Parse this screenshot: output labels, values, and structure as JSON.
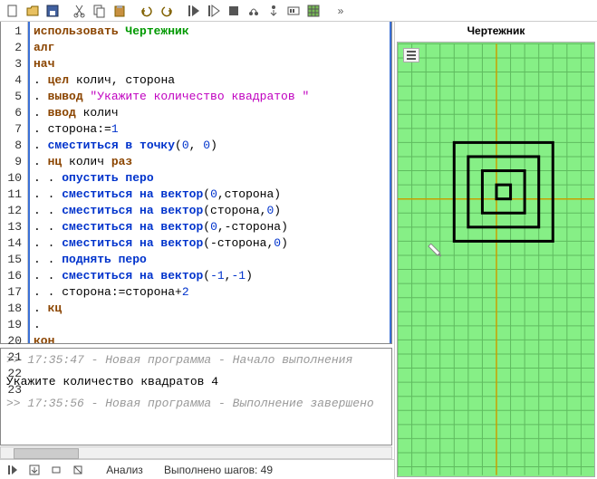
{
  "canvas": {
    "title": "Чертежник"
  },
  "toolbar_icons": [
    "new",
    "open",
    "save",
    "cut",
    "copy",
    "paste",
    "undo",
    "redo",
    "run",
    "run-skip",
    "stop",
    "step-over",
    "step-into",
    "pair",
    "grid",
    "more"
  ],
  "code": {
    "lines": [
      {
        "n": 1,
        "segs": [
          [
            "k-brown",
            "использовать "
          ],
          [
            "k-green",
            "Чертежник"
          ]
        ]
      },
      {
        "n": 2,
        "segs": [
          [
            "k-brown",
            "алг"
          ]
        ]
      },
      {
        "n": 3,
        "segs": [
          [
            "k-brown",
            "нач"
          ]
        ]
      },
      {
        "n": 4,
        "segs": [
          [
            "",
            ". "
          ],
          [
            "k-brown",
            "цел "
          ],
          [
            "",
            "колич, сторона"
          ]
        ]
      },
      {
        "n": 5,
        "segs": [
          [
            "",
            ". "
          ],
          [
            "k-brown",
            "вывод "
          ],
          [
            "k-mag",
            "\"Укажите количество квадратов \""
          ]
        ]
      },
      {
        "n": 6,
        "segs": [
          [
            "",
            ". "
          ],
          [
            "k-brown",
            "ввод "
          ],
          [
            "",
            "колич"
          ]
        ]
      },
      {
        "n": 7,
        "segs": [
          [
            "",
            ". сторона:="
          ],
          [
            "k-num",
            "1"
          ]
        ]
      },
      {
        "n": 8,
        "segs": [
          [
            "",
            ". "
          ],
          [
            "k-blue",
            "сместиться в точку"
          ],
          [
            "",
            "("
          ],
          [
            "k-num",
            "0"
          ],
          [
            "",
            ", "
          ],
          [
            "k-num",
            "0"
          ],
          [
            "",
            ")"
          ]
        ]
      },
      {
        "n": 9,
        "segs": [
          [
            "",
            ". "
          ],
          [
            "k-brown",
            "нц "
          ],
          [
            "",
            "колич "
          ],
          [
            "k-brown",
            "раз"
          ]
        ]
      },
      {
        "n": 10,
        "segs": [
          [
            "",
            ". . "
          ],
          [
            "k-blue",
            "опустить перо"
          ]
        ]
      },
      {
        "n": 11,
        "segs": [
          [
            "",
            ". . "
          ],
          [
            "k-blue",
            "сместиться на вектор"
          ],
          [
            "",
            "("
          ],
          [
            "k-num",
            "0"
          ],
          [
            "",
            ",сторона)"
          ]
        ]
      },
      {
        "n": 12,
        "segs": [
          [
            "",
            ". . "
          ],
          [
            "k-blue",
            "сместиться на вектор"
          ],
          [
            "",
            "(сторона,"
          ],
          [
            "k-num",
            "0"
          ],
          [
            "",
            ")"
          ]
        ]
      },
      {
        "n": 13,
        "segs": [
          [
            "",
            ". . "
          ],
          [
            "k-blue",
            "сместиться на вектор"
          ],
          [
            "",
            "("
          ],
          [
            "k-num",
            "0"
          ],
          [
            "",
            ",-сторона)"
          ]
        ]
      },
      {
        "n": 14,
        "segs": [
          [
            "",
            ". . "
          ],
          [
            "k-blue",
            "сместиться на вектор"
          ],
          [
            "",
            "(-сторона,"
          ],
          [
            "k-num",
            "0"
          ],
          [
            "",
            ")"
          ]
        ]
      },
      {
        "n": 15,
        "segs": [
          [
            "",
            ". . "
          ],
          [
            "k-blue",
            "поднять перо"
          ]
        ]
      },
      {
        "n": 16,
        "segs": [
          [
            "",
            ". . "
          ],
          [
            "k-blue",
            "сместиться на вектор"
          ],
          [
            "",
            "("
          ],
          [
            "k-num",
            "-1"
          ],
          [
            "",
            ","
          ],
          [
            "k-num",
            "-1"
          ],
          [
            "",
            ")"
          ]
        ]
      },
      {
        "n": 17,
        "segs": [
          [
            "",
            ". . сторона:=сторона+"
          ],
          [
            "k-num",
            "2"
          ]
        ]
      },
      {
        "n": 18,
        "segs": [
          [
            "",
            ". "
          ],
          [
            "k-brown",
            "кц"
          ]
        ]
      },
      {
        "n": 19,
        "segs": [
          [
            "",
            "."
          ]
        ]
      },
      {
        "n": 20,
        "segs": [
          [
            "k-brown",
            "кон"
          ]
        ]
      },
      {
        "n": 21,
        "segs": [],
        "empty": true
      },
      {
        "n": 22,
        "segs": [],
        "empty": true
      },
      {
        "n": 23,
        "segs": [],
        "empty": true
      }
    ]
  },
  "console": {
    "l1": ">> 17:35:47 - Новая программа - Начало выполнения",
    "out": "Укажите количество квадратов 4",
    "l2": ">> 17:35:56 - Новая программа - Выполнение завершено"
  },
  "status": {
    "analyze": "Анализ",
    "steps": "Выполнено шагов: 49"
  },
  "chart_data": {
    "type": "drawing",
    "description": "4 concentric squares on green grid, pen at (-4,-4)",
    "grid_spacing": 1,
    "origin_cell": [
      7,
      11
    ],
    "squares": [
      {
        "x": 0,
        "y": 0,
        "size": 1
      },
      {
        "x": -1,
        "y": -1,
        "size": 3
      },
      {
        "x": -2,
        "y": -2,
        "size": 5
      },
      {
        "x": -3,
        "y": -3,
        "size": 7
      }
    ],
    "pen": {
      "x": -4,
      "y": -4
    }
  }
}
